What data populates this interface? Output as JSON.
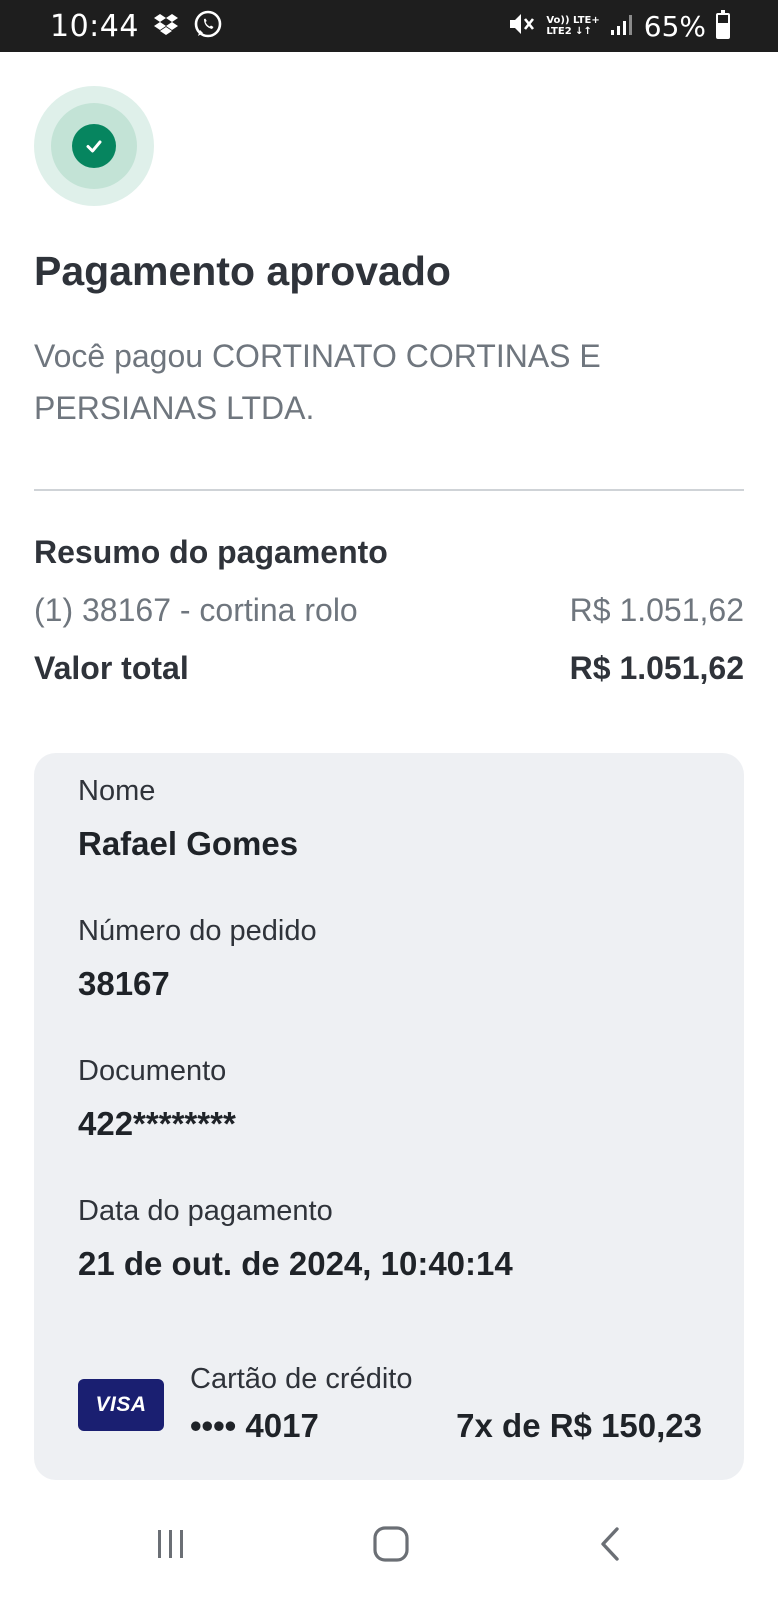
{
  "status_bar": {
    "time": "10:44",
    "net_top": "Vo)) LTE+",
    "net_bottom": "LTE2 ↓↑",
    "battery": "65%",
    "battery_level": 0.65,
    "icons": [
      "dropbox-icon",
      "whatsapp-icon",
      "mute-icon",
      "signal-icon",
      "battery-icon"
    ]
  },
  "header": {
    "title": "Pagamento aprovado",
    "subtitle": "Você pagou CORTINATO CORTINAS E PERSIANAS LTDA."
  },
  "summary": {
    "title": "Resumo do pagamento",
    "item_label": "(1) 38167 - cortina rolo",
    "item_value": "R$ 1.051,62",
    "total_label": "Valor total",
    "total_value": "R$ 1.051,62"
  },
  "details": {
    "name_label": "Nome",
    "name_value": "Rafael Gomes",
    "order_label": "Número do pedido",
    "order_value": "38167",
    "document_label": "Documento",
    "document_value": "422********",
    "date_label": "Data do pagamento",
    "date_value": "21 de out. de 2024, 10:40:14",
    "card_brand": "VISA",
    "card_type": "Cartão de crédito",
    "card_number": "•••• 4017",
    "installments": "7x de R$ 150,23"
  },
  "colors": {
    "success": "#06855f",
    "visa": "#1a1f71",
    "card_bg": "#eef0f3"
  }
}
